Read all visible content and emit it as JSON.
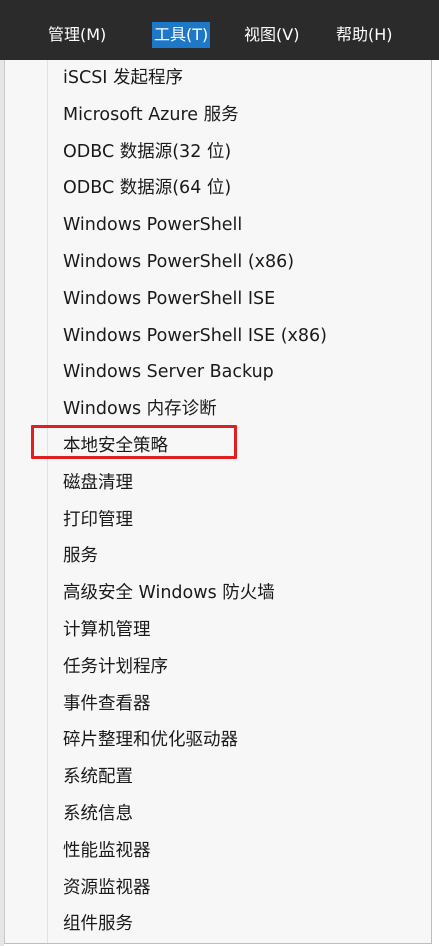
{
  "menubar": {
    "items": [
      {
        "label": "管理(M)",
        "active": false
      },
      {
        "label": "工具(T)",
        "active": true
      },
      {
        "label": "视图(V)",
        "active": false
      },
      {
        "label": "帮助(H)",
        "active": false
      }
    ],
    "active_color": "#1e78c8",
    "background_color": "#2b2b2b"
  },
  "tools_menu": {
    "items": [
      "iSCSI 发起程序",
      "Microsoft Azure 服务",
      "ODBC 数据源(32 位)",
      "ODBC 数据源(64 位)",
      "Windows PowerShell",
      "Windows PowerShell (x86)",
      "Windows PowerShell ISE",
      "Windows PowerShell ISE (x86)",
      "Windows Server Backup",
      "Windows 内存诊断",
      "本地安全策略",
      "磁盘清理",
      "打印管理",
      "服务",
      "高级安全 Windows 防火墙",
      "计算机管理",
      "任务计划程序",
      "事件查看器",
      "碎片整理和优化驱动器",
      "系统配置",
      "系统信息",
      "性能监视器",
      "资源监视器",
      "组件服务"
    ],
    "highlighted_item": "本地安全策略",
    "highlight_color": "#e02020"
  }
}
